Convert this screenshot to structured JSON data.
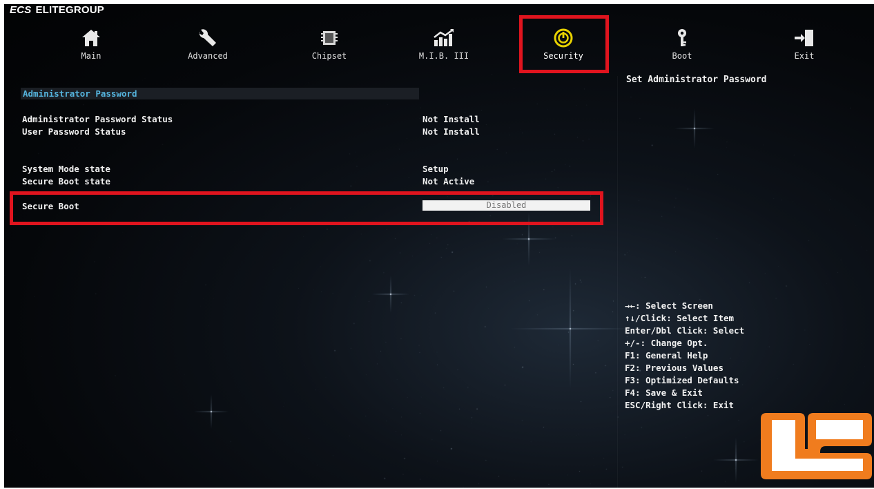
{
  "brand": {
    "logo_text": "ECS",
    "name": "ELITEGROUP"
  },
  "tabs": [
    {
      "label": "Main",
      "icon": "home-icon"
    },
    {
      "label": "Advanced",
      "icon": "wrench-icon"
    },
    {
      "label": "Chipset",
      "icon": "chip-icon"
    },
    {
      "label": "M.I.B. III",
      "icon": "chart-icon"
    },
    {
      "label": "Security",
      "icon": "power-lock-icon",
      "active": true
    },
    {
      "label": "Boot",
      "icon": "key-icon"
    },
    {
      "label": "Exit",
      "icon": "exit-door-icon"
    }
  ],
  "main": {
    "section_title": "Administrator Password",
    "rows": [
      {
        "label": "Administrator Password Status",
        "value": "Not Install"
      },
      {
        "label": "User Password Status",
        "value": "Not Install"
      },
      {
        "label": "System Mode state",
        "value": "Setup"
      },
      {
        "label": "Secure Boot state",
        "value": "Not Active"
      }
    ],
    "secure_boot": {
      "label": "Secure Boot",
      "value": "Disabled"
    }
  },
  "help": {
    "title": "Set Administrator Password",
    "keys": [
      "→←: Select Screen",
      "↑↓/Click: Select Item",
      "Enter/Dbl Click: Select",
      "+/-: Change Opt.",
      "F1: General Help",
      "F2: Previous Values",
      "F3: Optimized Defaults",
      "F4: Save & Exit",
      "ESC/Right Click: Exit"
    ]
  },
  "colors": {
    "highlight_box": "#e0141e",
    "section_title": "#55b3dc",
    "security_icon": "#e8d200",
    "watermark": "#f07c1e"
  }
}
